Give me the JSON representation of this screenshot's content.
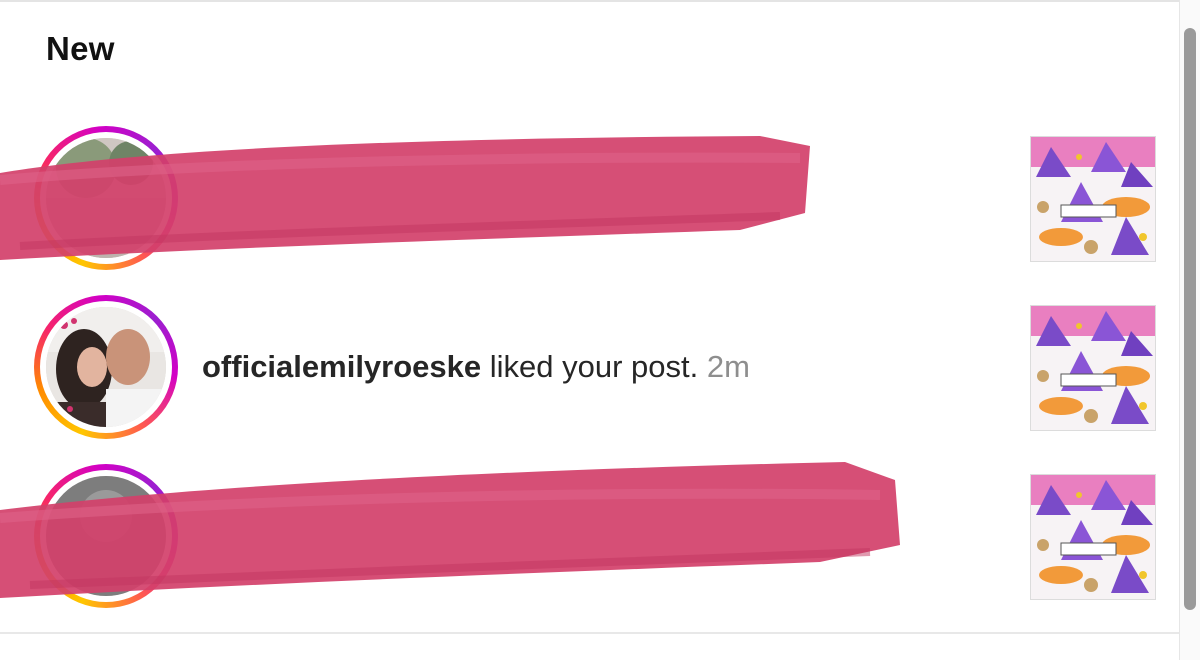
{
  "section": {
    "title": "New"
  },
  "notifications": [
    {
      "username": "",
      "action": "",
      "time": "",
      "redacted": true
    },
    {
      "username": "officialemilyroeske",
      "action": " liked your post. ",
      "time": "2m",
      "redacted": false
    },
    {
      "username": "",
      "action": "",
      "time": "",
      "redacted": true
    }
  ],
  "colors": {
    "redaction": "#d2406a",
    "ring_start": "#ffc600",
    "ring_end": "#d300c5",
    "username": "#262626",
    "timestamp": "#8e8e8e"
  },
  "icons": {
    "post_thumbnail": "sister-witches-sticker-pattern"
  }
}
